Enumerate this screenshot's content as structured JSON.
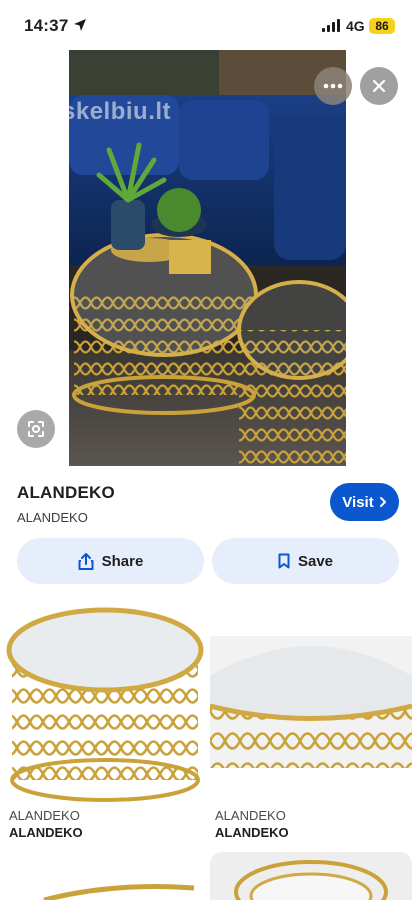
{
  "status_bar": {
    "time": "14:37",
    "network": "4G",
    "battery": "86",
    "colors": {
      "battery_badge": "#f7d21a"
    }
  },
  "hero": {
    "watermark": "skelbiu.lt",
    "icons": [
      "more-horizontal-icon",
      "close-icon",
      "lens-icon"
    ]
  },
  "source": {
    "title": "ALANDEKO",
    "subtitle": "ALANDEKO",
    "visit_label": "Visit"
  },
  "actions": {
    "share_label": "Share",
    "save_label": "Save",
    "colors": {
      "pill_bg": "#e6edfb",
      "visit_bg": "#0b57d0"
    }
  },
  "results": [
    {
      "source": "ALANDEKO",
      "name": "ALANDEKO"
    },
    {
      "source": "ALANDEKO",
      "name": "ALANDEKO"
    },
    {
      "source": "",
      "name": ""
    },
    {
      "source": "",
      "name": ""
    }
  ]
}
